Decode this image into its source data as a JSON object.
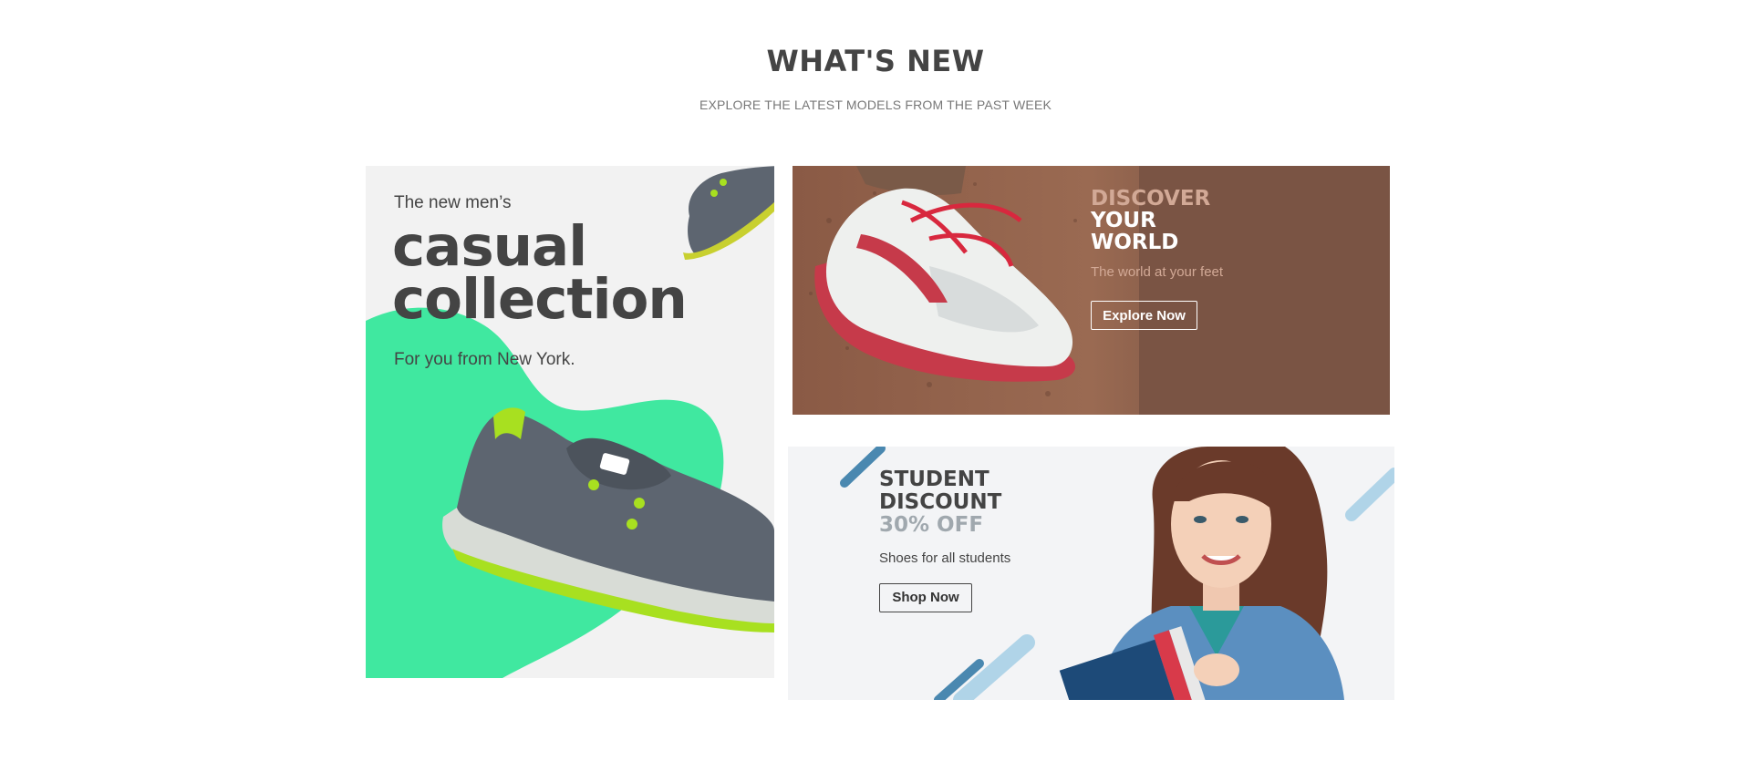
{
  "section": {
    "title": "WHAT'S NEW",
    "subtitle": "EXPLORE THE LATEST MODELS FROM THE PAST WEEK"
  },
  "card_casual": {
    "pretitle": "The new men’s",
    "title_line1": "casual",
    "title_line2": "collection",
    "subtitle": "For you from New York.",
    "accent_color": "#40e8a0"
  },
  "card_discover": {
    "heading_line1": "DISCOVER",
    "heading_line2": "YOUR",
    "heading_line3": "WORLD",
    "tagline": "The world at your feet",
    "button_label": "Explore Now",
    "background_color": "#7a5444"
  },
  "card_student": {
    "heading_line1": "STUDENT",
    "heading_line2": "DISCOUNT",
    "heading_line3": "30% OFF",
    "description": "Shoes for all students",
    "button_label": "Shop Now",
    "stripe_color": "#4a88b0"
  }
}
